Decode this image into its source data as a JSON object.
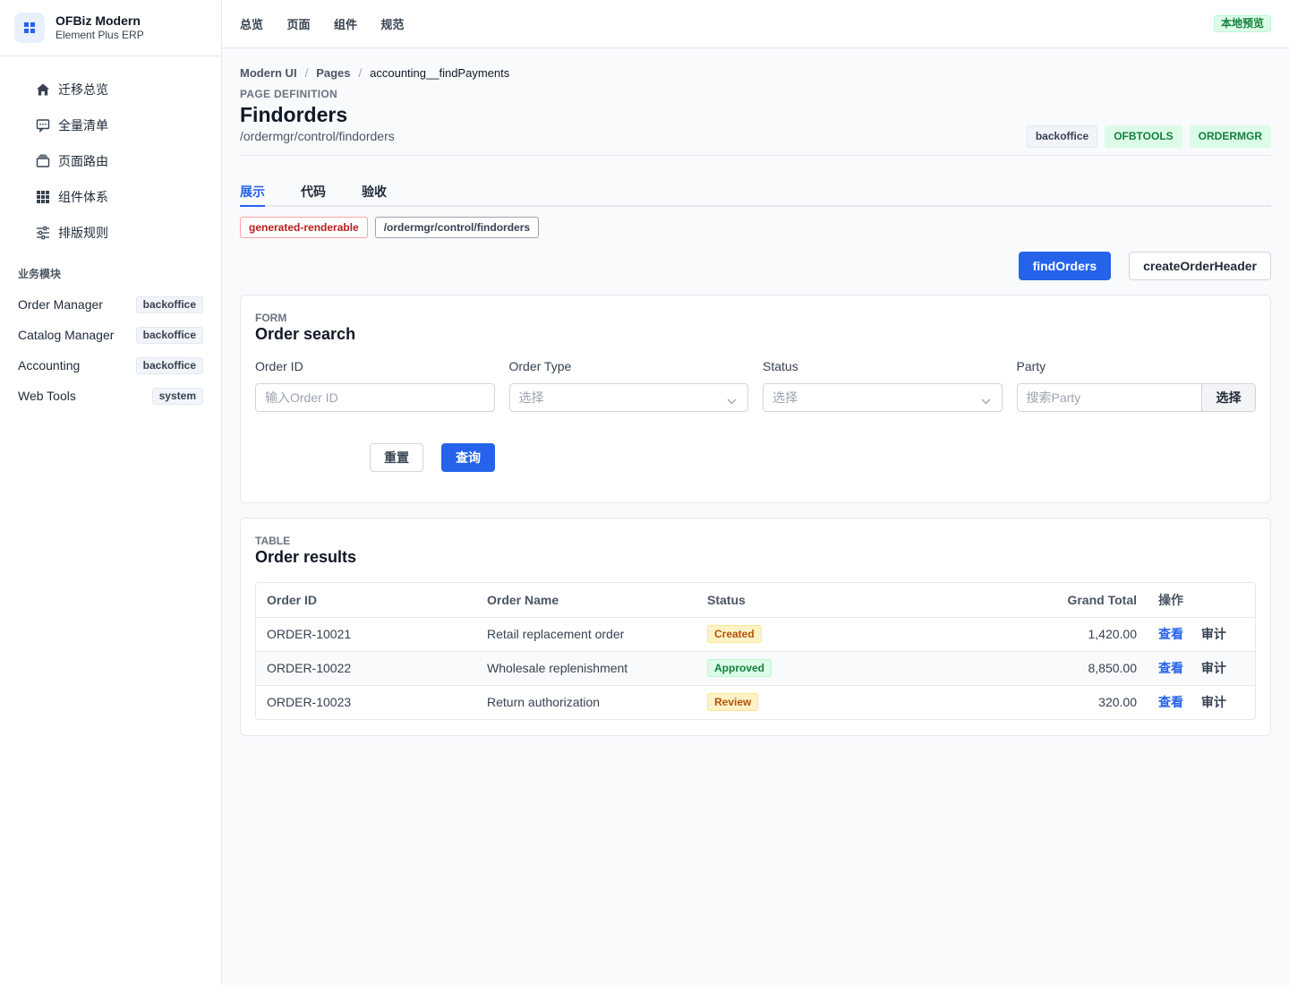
{
  "brand": {
    "title": "OFBiz Modern",
    "subtitle": "Element Plus ERP"
  },
  "sidebar": {
    "nav": [
      {
        "label": "迁移总览",
        "icon": "home-icon"
      },
      {
        "label": "全量清单",
        "icon": "chat-icon"
      },
      {
        "label": "页面路由",
        "icon": "layers-icon"
      },
      {
        "label": "组件体系",
        "icon": "grid-icon"
      },
      {
        "label": "排版规则",
        "icon": "sliders-icon"
      }
    ],
    "section_label": "业务模块",
    "modules": [
      {
        "label": "Order Manager",
        "tag": "backoffice"
      },
      {
        "label": "Catalog Manager",
        "tag": "backoffice"
      },
      {
        "label": "Accounting",
        "tag": "backoffice"
      },
      {
        "label": "Web Tools",
        "tag": "system"
      }
    ]
  },
  "topbar": {
    "links": [
      "总览",
      "页面",
      "组件",
      "规范"
    ],
    "badge": "本地预览"
  },
  "breadcrumb": {
    "items": [
      "Modern UI",
      "Pages",
      "accounting__findPayments"
    ]
  },
  "header": {
    "kicker": "PAGE DEFINITION",
    "title": "Findorders",
    "path": "/ordermgr/control/findorders",
    "tags": [
      "backoffice",
      "OFBTOOLS",
      "ORDERMGR"
    ]
  },
  "tabs": [
    "展示",
    "代码",
    "验收"
  ],
  "chips": [
    "generated-renderable",
    "/ordermgr/control/findorders"
  ],
  "actions": {
    "primary": "findOrders",
    "secondary": "createOrderHeader"
  },
  "form": {
    "kicker": "FORM",
    "title": "Order search",
    "fields": [
      {
        "label": "Order ID",
        "placeholder": "输入Order ID"
      },
      {
        "label": "Order Type",
        "placeholder": "选择"
      },
      {
        "label": "Status",
        "placeholder": "选择"
      },
      {
        "label": "Party",
        "placeholder": "搜索Party",
        "addon": "选择"
      }
    ],
    "reset": "重置",
    "submit": "查询"
  },
  "table": {
    "kicker": "TABLE",
    "title": "Order results",
    "columns": [
      "Order ID",
      "Order Name",
      "Status",
      "Grand Total",
      "操作"
    ],
    "rows": [
      {
        "id": "ORDER-10021",
        "name": "Retail replacement order",
        "status": "Created",
        "total": "1,420.00"
      },
      {
        "id": "ORDER-10022",
        "name": "Wholesale replenishment",
        "status": "Approved",
        "total": "8,850.00"
      },
      {
        "id": "ORDER-10023",
        "name": "Return authorization",
        "status": "Review",
        "total": "320.00"
      }
    ],
    "row_actions": [
      "查看",
      "审计"
    ]
  },
  "colors": {
    "primary": "#2563eb",
    "success": "#15803d",
    "warning": "#b45309",
    "danger": "#b91c1c"
  }
}
